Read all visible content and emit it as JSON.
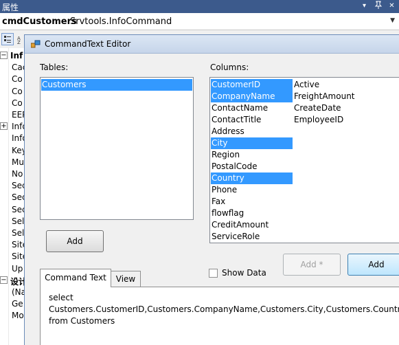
{
  "property_panel": {
    "title": "属性",
    "pin_glyph": "▾",
    "dock_glyph": "📌",
    "close_glyph": "✕",
    "object_name": "cmdCustomers",
    "object_type": "Srvtools.InfoCommand",
    "rows": [
      {
        "expander": "⊟",
        "text": "Inf",
        "kind": "category"
      },
      {
        "expander": "",
        "text": "Cac",
        "kind": "property"
      },
      {
        "expander": "",
        "text": "Co",
        "kind": "property"
      },
      {
        "expander": "",
        "text": "Co",
        "kind": "property"
      },
      {
        "expander": "",
        "text": "Co",
        "kind": "property"
      },
      {
        "expander": "",
        "text": "EEP",
        "kind": "property"
      },
      {
        "expander": "⊞",
        "text": "Info",
        "kind": "property"
      },
      {
        "expander": "",
        "text": "Info",
        "kind": "property"
      },
      {
        "expander": "",
        "text": "Key",
        "kind": "property"
      },
      {
        "expander": "",
        "text": "Mu",
        "kind": "property"
      },
      {
        "expander": "",
        "text": "No",
        "kind": "property"
      },
      {
        "expander": "",
        "text": "Sec",
        "kind": "property"
      },
      {
        "expander": "",
        "text": "Sec",
        "kind": "property"
      },
      {
        "expander": "",
        "text": "Sec",
        "kind": "property"
      },
      {
        "expander": "",
        "text": "Sel",
        "kind": "property"
      },
      {
        "expander": "",
        "text": "Sel",
        "kind": "property"
      },
      {
        "expander": "",
        "text": "Site",
        "kind": "property"
      },
      {
        "expander": "",
        "text": "Site",
        "kind": "property"
      },
      {
        "expander": "",
        "text": "Up",
        "kind": "property"
      },
      {
        "expander": "⊟",
        "text": "设计",
        "kind": "category"
      },
      {
        "expander": "",
        "text": "(Na",
        "kind": "property"
      },
      {
        "expander": "",
        "text": "Ge",
        "kind": "property"
      },
      {
        "expander": "",
        "text": "Mo",
        "kind": "property"
      }
    ]
  },
  "dialog": {
    "title": "CommandText Editor",
    "tables_label": "Tables:",
    "columns_label": "Columns:",
    "tables": [
      {
        "name": "Customers",
        "selected": true
      }
    ],
    "columns_left": [
      {
        "name": "CustomerID",
        "selected": true
      },
      {
        "name": "CompanyName",
        "selected": true
      },
      {
        "name": "ContactName",
        "selected": false
      },
      {
        "name": "ContactTitle",
        "selected": false
      },
      {
        "name": "Address",
        "selected": false
      },
      {
        "name": "City",
        "selected": true
      },
      {
        "name": "Region",
        "selected": false
      },
      {
        "name": "PostalCode",
        "selected": false
      },
      {
        "name": "Country",
        "selected": true
      },
      {
        "name": "Phone",
        "selected": false
      },
      {
        "name": "Fax",
        "selected": false
      },
      {
        "name": "flowflag",
        "selected": false
      },
      {
        "name": "CreditAmount",
        "selected": false
      },
      {
        "name": "ServiceRole",
        "selected": false
      }
    ],
    "columns_right": [
      {
        "name": "Active",
        "selected": false
      },
      {
        "name": "FreightAmount",
        "selected": false
      },
      {
        "name": "CreateDate",
        "selected": false
      },
      {
        "name": "EmployeeID",
        "selected": false
      }
    ],
    "add_table_label": "Add",
    "add_star_label": "Add *",
    "add_column_label": "Add",
    "show_data_label": "Show Data",
    "show_data_checked": false,
    "tabs": [
      {
        "label": "Command Text",
        "active": true
      },
      {
        "label": "View",
        "active": false
      }
    ],
    "command_text_lines": [
      "select",
      "Customers.CustomerID,Customers.CompanyName,Customers.City,Customers.Country",
      "from Customers"
    ]
  },
  "colors": {
    "selection": "#3399ff",
    "titlebar": "#3c5a8c"
  }
}
